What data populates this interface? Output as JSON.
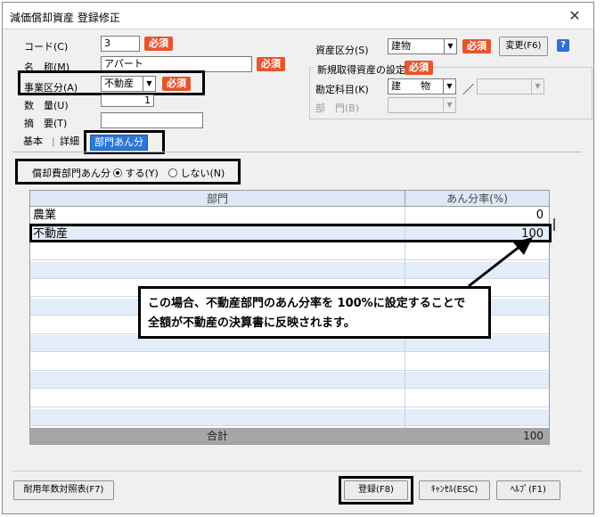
{
  "window": {
    "title": "減価償却資産 登録修正",
    "close_glyph": "✕"
  },
  "form": {
    "code": {
      "label": "コード(C)",
      "value": "3"
    },
    "name": {
      "label": "名　称(M)",
      "value": "アパート"
    },
    "business": {
      "label": "事業区分(A)",
      "value": "不動産"
    },
    "quantity": {
      "label": "数　量(U)",
      "value": "1"
    },
    "memo": {
      "label": "摘　要(T)",
      "value": ""
    },
    "required": "必須"
  },
  "asset_class": {
    "label": "資産区分(S)",
    "value": "建物",
    "change_button": "変更(F6)",
    "help": "?"
  },
  "new_asset": {
    "group_label": "新規取得資産の設定",
    "account_label": "勘定科目(K)",
    "account_value": "建　　物",
    "separator": "／",
    "department_label": "部　門(B)"
  },
  "tabs": [
    {
      "label": "基本"
    },
    {
      "label": "詳細"
    },
    {
      "label": "部門あん分"
    }
  ],
  "allocation": {
    "label": "償却費部門あん分",
    "yes": "する(Y)",
    "no": "しない(N)"
  },
  "grid": {
    "headers": {
      "department": "部門",
      "ratio": "あん分率(%)"
    },
    "rows": [
      {
        "department": "農業",
        "ratio": "0"
      },
      {
        "department": "不動産",
        "ratio": "100"
      },
      {
        "department": "",
        "ratio": ""
      },
      {
        "department": "",
        "ratio": ""
      },
      {
        "department": "",
        "ratio": ""
      },
      {
        "department": "",
        "ratio": ""
      },
      {
        "department": "",
        "ratio": ""
      },
      {
        "department": "",
        "ratio": ""
      },
      {
        "department": "",
        "ratio": ""
      },
      {
        "department": "",
        "ratio": ""
      },
      {
        "department": "",
        "ratio": ""
      },
      {
        "department": "",
        "ratio": ""
      }
    ],
    "total_label": "合計",
    "total_value": "100"
  },
  "callout": {
    "line1": "この場合、不動産部門のあん分率を 100%に設定することで",
    "line2": "全額が不動産の決算書に反映されます。"
  },
  "footer": {
    "useful_life": "耐用年数対照表(F7)",
    "register": "登録(F8)",
    "cancel": "ｷｬﾝｾﾙ(ESC)",
    "help": "ﾍﾙﾌﾟ(F1)"
  }
}
